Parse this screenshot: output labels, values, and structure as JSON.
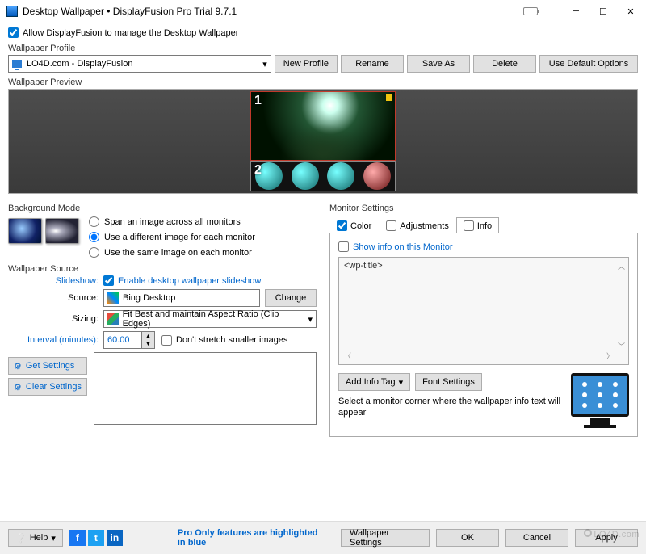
{
  "title": "Desktop Wallpaper • DisplayFusion Pro Trial 9.7.1",
  "allow_label": "Allow DisplayFusion to manage the Desktop Wallpaper",
  "sections": {
    "profile": "Wallpaper Profile",
    "preview": "Wallpaper Preview",
    "bg_mode": "Background Mode",
    "source": "Wallpaper Source",
    "monitor": "Monitor Settings"
  },
  "profile": {
    "selected": "LO4D.com - DisplayFusion",
    "buttons": {
      "new": "New Profile",
      "rename": "Rename",
      "saveas": "Save As",
      "delete": "Delete",
      "defaults": "Use Default Options"
    }
  },
  "preview": {
    "m1": "1",
    "m2": "2"
  },
  "bg_mode": {
    "span": "Span an image across all monitors",
    "diff": "Use a different image for each monitor",
    "same": "Use the same image on each monitor"
  },
  "source_form": {
    "slideshow_lbl": "Slideshow:",
    "slideshow_chk": "Enable desktop wallpaper slideshow",
    "source_lbl": "Source:",
    "source_val": "Bing Desktop",
    "change": "Change",
    "sizing_lbl": "Sizing:",
    "sizing_val": "Fit Best and maintain Aspect Ratio (Clip Edges)",
    "interval_lbl": "Interval (minutes):",
    "interval_val": "60.00",
    "nostretch": "Don't stretch smaller images",
    "get": "Get Settings",
    "clear": "Clear Settings"
  },
  "tabs": {
    "color": "Color",
    "adjust": "Adjustments",
    "info": "Info"
  },
  "info_panel": {
    "show": "Show info on this Monitor",
    "placeholder": "<wp-title>",
    "add_tag": "Add Info Tag",
    "font": "Font Settings",
    "hint": "Select a monitor corner where the wallpaper info text will appear"
  },
  "footer": {
    "help": "Help",
    "pro_note": "Pro Only features are highlighted in blue",
    "wp_settings": "Wallpaper Settings",
    "ok": "OK",
    "cancel": "Cancel",
    "apply": "Apply"
  },
  "watermark": "LO4D.com"
}
